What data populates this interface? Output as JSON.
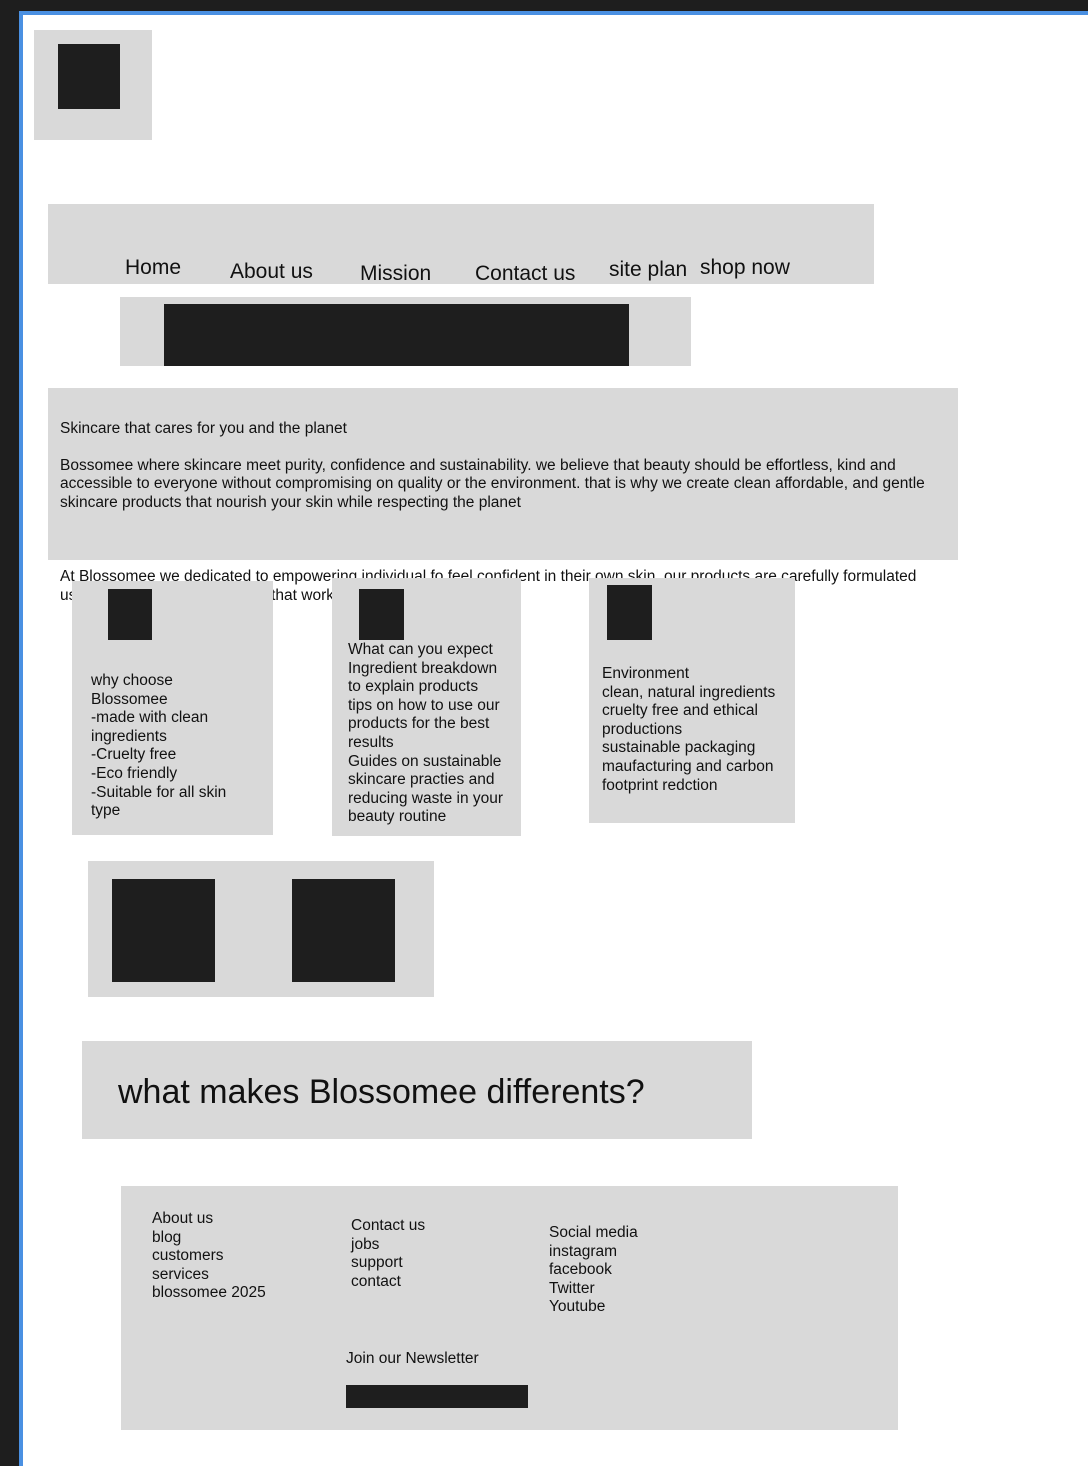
{
  "nav": {
    "items": [
      {
        "label": "Home"
      },
      {
        "label": "About us"
      },
      {
        "label": "Mission"
      },
      {
        "label": "Contact us"
      },
      {
        "label": "site plan"
      },
      {
        "label": "shop now"
      }
    ]
  },
  "intro": {
    "heading": "Skincare that cares for you and the planet",
    "paragraph1": "Bossomee where skincare meet purity, confidence and sustainability. we believe that beauty should be effortless, kind and accessible to everyone without compromising on quality or the environment. that is why we create clean affordable, and gentle skincare products that nourish your skin while respecting the planet",
    "paragraph2": "At Blossomee we dedicated to empowering individual fo feel confident in their own skin. our products are carefully formulated using safe, natural ingredients that work well with all skin type"
  },
  "cards": [
    {
      "text": "why choose\nBlossomee\n-made with clean\ningredients\n-Cruelty free\n-Eco friendly\n-Suitable for all skin\ntype"
    },
    {
      "text": "What can you expect\nIngredient breakdown\nto explain products\ntips on how to use our\nproducts for the best\nresults\nGuides on sustainable\nskincare practies and\nreducing waste in your\nbeauty routine"
    },
    {
      "text": "Environment\nclean, natural ingredients\ncruelty free and ethical\nproductions\nsustainable packaging\nmaufacturing and carbon\nfootprint redction"
    }
  ],
  "headline": "what makes Blossomee differents?",
  "footer": {
    "col1": [
      "About us",
      "blog",
      "customers",
      "services",
      "blossomee 2025"
    ],
    "col2": [
      "Contact us",
      "jobs",
      "support",
      "contact"
    ],
    "col3": [
      "Social media",
      "instagram",
      "facebook",
      "Twitter",
      "Youtube"
    ],
    "newsletter_label": "Join our Newsletter"
  },
  "colors": {
    "placeholder_gray": "#d9d9d9",
    "placeholder_dark": "#1e1e1e",
    "frame_accent": "#4a90e2"
  }
}
